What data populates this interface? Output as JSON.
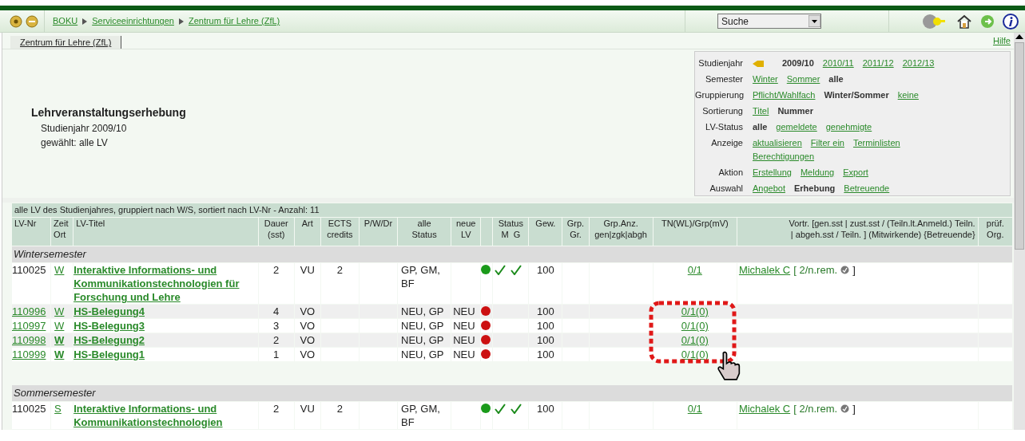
{
  "breadcrumb": [
    "BOKU",
    "Serviceeinrichtungen",
    "Zentrum für Lehre (ZfL)"
  ],
  "search": {
    "value": "Suche"
  },
  "tab": {
    "label": "Zentrum für Lehre (ZfL)"
  },
  "help": "Hilfe",
  "heading": {
    "title": "Lehrveranstaltungserhebung",
    "year": "Studienjahr 2009/10",
    "selection": "gewählt: alle LV"
  },
  "filters": [
    {
      "label": "Studienjahr",
      "prev_arrow": true,
      "options": [
        {
          "text": "2009/10",
          "selected": true
        },
        {
          "text": "2010/11",
          "selected": false
        },
        {
          "text": "2011/12",
          "selected": false
        },
        {
          "text": "2012/13",
          "selected": false
        }
      ]
    },
    {
      "label": "Semester",
      "options": [
        {
          "text": "Winter",
          "selected": false
        },
        {
          "text": "Sommer",
          "selected": false
        },
        {
          "text": "alle",
          "selected": true
        }
      ]
    },
    {
      "label": "Gruppierung",
      "options": [
        {
          "text": "Pflicht/Wahlfach",
          "selected": false
        },
        {
          "text": "Winter/Sommer",
          "selected": true
        },
        {
          "text": "keine",
          "selected": false
        }
      ]
    },
    {
      "label": "Sortierung",
      "options": [
        {
          "text": "Titel",
          "selected": false
        },
        {
          "text": "Nummer",
          "selected": true
        }
      ]
    },
    {
      "label": "LV-Status",
      "options": [
        {
          "text": "alle",
          "selected": true
        },
        {
          "text": "gemeldete",
          "selected": false
        },
        {
          "text": "genehmigte",
          "selected": false
        }
      ]
    },
    {
      "label": "Anzeige",
      "options": [
        {
          "text": "aktualisieren",
          "selected": false
        },
        {
          "text": "Filter ein",
          "selected": false
        },
        {
          "text": "Terminlisten",
          "selected": false
        },
        {
          "text": "Berechtigungen",
          "selected": false
        }
      ]
    },
    {
      "label": "Aktion",
      "options": [
        {
          "text": "Erstellung",
          "selected": false
        },
        {
          "text": "Meldung",
          "selected": false
        },
        {
          "text": "Export",
          "selected": false
        }
      ]
    },
    {
      "label": "Auswahl",
      "options": [
        {
          "text": "Angebot",
          "selected": false
        },
        {
          "text": "Erhebung",
          "selected": true
        },
        {
          "text": "Betreuende",
          "selected": false
        }
      ]
    }
  ],
  "table": {
    "caption": "alle LV des Studienjahres, gruppiert nach W/S, sortiert nach LV-Nr - Anzahl: 11",
    "columns": [
      [
        "LV-Nr"
      ],
      [
        "Zeit",
        "Ort"
      ],
      [
        "LV-Titel"
      ],
      [
        "Dauer",
        "(sst)"
      ],
      [
        "Art"
      ],
      [
        "ECTS",
        "credits"
      ],
      [
        "P/W/Dr"
      ],
      [
        "alle",
        "Status"
      ],
      [
        "neue",
        "LV"
      ],
      [],
      [
        "Status",
        "M  G"
      ],
      [
        "Gew."
      ],
      [
        "Grp.",
        "Gr."
      ],
      [
        "Grp.Anz.",
        "gen|zgk|abgh"
      ],
      [
        "TN(WL)/Grp(mV)"
      ],
      [
        "Vortr. [gen.sst | zust.sst / (Teiln.lt.Anmeld.) Teiln.",
        "| abgeh.sst / Teiln. ] (Mitwirkende) {Betreuende}"
      ],
      [
        "prüf.",
        "Org."
      ]
    ],
    "groups": [
      {
        "title": "Wintersemester",
        "rows": [
          {
            "nr": "110025",
            "nr_link": false,
            "zeit": "W",
            "zeit_bold": false,
            "title": "Interaktive Informations- und Kommunikationstechnologien für Forschung und Lehre",
            "dauer": "2",
            "art": "VU",
            "ects": "2",
            "status": "GP, GM, BF",
            "neu": "",
            "color": "#1a9a1a",
            "m_ok": true,
            "g_ok": true,
            "gew": "100",
            "tn": "0/1",
            "vortr": "Michalek C",
            "vortr_info": "[ 2/n.rem.",
            "vortr_end": "]"
          },
          {
            "nr": "110996",
            "nr_link": true,
            "zeit": "W",
            "zeit_bold": false,
            "title": "HS-Belegung4",
            "dauer": "4",
            "art": "VO",
            "ects": "",
            "status": "NEU, GP",
            "neu": "NEU",
            "color": "#cc1111",
            "m_ok": false,
            "g_ok": false,
            "gew": "100",
            "tn": "0/1(0)"
          },
          {
            "nr": "110997",
            "nr_link": true,
            "zeit": "W",
            "zeit_bold": false,
            "title": "HS-Belegung3",
            "dauer": "3",
            "art": "VO",
            "ects": "",
            "status": "NEU, GP",
            "neu": "NEU",
            "color": "#cc1111",
            "m_ok": false,
            "g_ok": false,
            "gew": "100",
            "tn": "0/1(0)"
          },
          {
            "nr": "110998",
            "nr_link": true,
            "zeit": "W",
            "zeit_bold": true,
            "title": "HS-Belegung2",
            "dauer": "2",
            "art": "VO",
            "ects": "",
            "status": "NEU, GP",
            "neu": "NEU",
            "color": "#cc1111",
            "m_ok": false,
            "g_ok": false,
            "gew": "100",
            "tn": "0/1(0)"
          },
          {
            "nr": "110999",
            "nr_link": true,
            "zeit": "W",
            "zeit_bold": true,
            "title": "HS-Belegung1",
            "dauer": "1",
            "art": "VO",
            "ects": "",
            "status": "NEU, GP",
            "neu": "NEU",
            "color": "#cc1111",
            "m_ok": false,
            "g_ok": false,
            "gew": "100",
            "tn": "0/1(0)"
          }
        ]
      },
      {
        "title": "Sommersemester",
        "rows": [
          {
            "nr": "110025",
            "nr_link": false,
            "zeit": "S",
            "zeit_bold": false,
            "title": "Interaktive Informations- und Kommunikationstechnologien",
            "dauer": "2",
            "art": "VU",
            "ects": "2",
            "status": "GP, GM, BF",
            "neu": "",
            "color": "#1a9a1a",
            "m_ok": true,
            "g_ok": true,
            "gew": "100",
            "tn": "0/1",
            "vortr": "Michalek C",
            "vortr_info": "[ 2/n.rem.",
            "vortr_end": "]"
          }
        ]
      }
    ]
  }
}
